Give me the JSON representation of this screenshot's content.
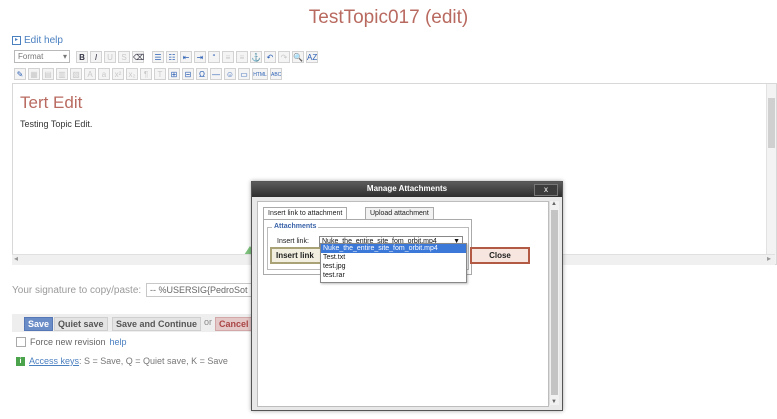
{
  "page": {
    "title": "TestTopic017 (edit)"
  },
  "edit_help": {
    "label": "Edit help"
  },
  "toolbar": {
    "format_label": "Format",
    "row1": [
      "B",
      "I",
      "U",
      "S",
      "⌫",
      "☰",
      "☷",
      "⇤",
      "⇥",
      "“",
      "≡",
      "≡",
      "⚓",
      "↶",
      "↷",
      "🔍",
      "AZ"
    ],
    "row2": [
      "✎",
      "▦",
      "▤",
      "▥",
      "▧",
      "A",
      "a",
      "x²",
      "x₂",
      "¶",
      "T",
      "⊞",
      "⊟",
      "Ω",
      "—",
      "☺",
      "▭",
      "HTML",
      "ABC"
    ]
  },
  "editor": {
    "heading": "Tert Edit",
    "body": "Testing Topic Edit."
  },
  "signature": {
    "label": "Your signature to copy/paste:",
    "value": "-- %USERSIG{PedroSot"
  },
  "actions": {
    "save": "Save",
    "quiet_save": "Quiet save",
    "save_continue": "Save and Continue",
    "or": "or",
    "cancel": "Cancel"
  },
  "force_revision": {
    "label": "Force new revision",
    "help": "help"
  },
  "access_keys": {
    "link": "Access keys",
    "text": ": S = Save, Q = Quiet save, K = Save"
  },
  "modal": {
    "title": "Manage Attachments",
    "close_icon": "x",
    "tabs": [
      "Insert link to attachment",
      "Upload attachment"
    ],
    "legend": "Attachments",
    "insert_link_label": "Insert link:",
    "selected_value": "Nuke_the_entire_site_fom_orbit.mp4",
    "options": [
      "Nuke_the_entire_site_fom_orbit.mp4",
      "Test.txt",
      "test.jpg",
      "test.rar"
    ],
    "insert_link_button": "Insert link",
    "close_button": "Close"
  }
}
